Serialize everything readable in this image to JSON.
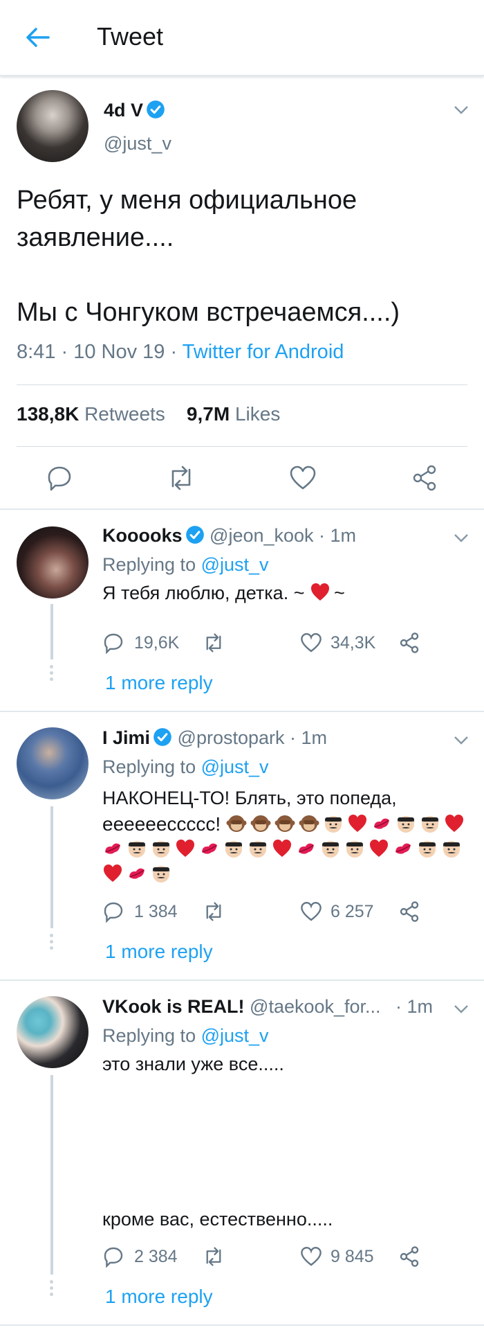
{
  "header": {
    "title": "Tweet"
  },
  "main_tweet": {
    "name": "4d V",
    "handle": "@just_v",
    "text_line1": "Ребят, у меня официальное",
    "text_line2": "заявление....",
    "text_line3": "Мы с Чонгуком встречаемся....)",
    "time": "8:41 · 10 Nov 19 · ",
    "source": "Twitter for Android",
    "retweets_count": "138,8K",
    "retweets_label": " Retweets",
    "likes_count": "9,7M",
    "likes_label": " Likes"
  },
  "replies": [
    {
      "name": "Kooooks",
      "handle": "@jeon_kook · 1m",
      "replying_prefix": "Replying to ",
      "replying_to": "@just_v",
      "text": "Я тебя люблю, детка. ~",
      "text_suffix": "~",
      "reply_count": "19,6K",
      "like_count": "34,3K",
      "more": "1 more reply"
    },
    {
      "name": "I Jimi",
      "handle": "@prostopark · 1m",
      "replying_prefix": "Replying to ",
      "replying_to": "@just_v",
      "text_line1": "НАКОНЕЦ-ТО! Блять, это попеда,",
      "text_line2": "еееееесcссс!",
      "reply_count": "1 384",
      "like_count": "6 257",
      "more": "1 more reply"
    },
    {
      "name": "VKook is REAL!",
      "handle": "@taekook_for...",
      "time": "· 1m",
      "replying_prefix": "Replying to ",
      "replying_to": "@just_v",
      "text_line1": "это знали уже все.....",
      "text_line2": "кроме вас, естественно.....",
      "reply_count": "2 384",
      "like_count": "9 845",
      "more": "1 more reply"
    }
  ],
  "colors": {
    "accent": "#1da1f2",
    "text": "#14171a",
    "secondary": "#657786"
  }
}
